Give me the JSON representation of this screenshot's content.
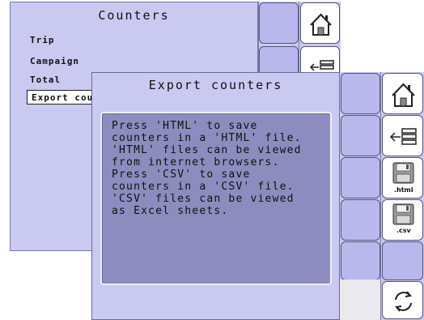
{
  "background_screen": {
    "title": "Counters",
    "items": [
      {
        "label": "Trip"
      },
      {
        "label": "Campaign"
      },
      {
        "label": "Total"
      },
      {
        "label": "Export coun"
      }
    ]
  },
  "dialog": {
    "title": "Export counters",
    "message": "Press 'HTML' to save\ncounters in  a 'HTML' file.\n'HTML' files can be viewed\nfrom internet browsers.\nPress 'CSV' to save\ncounters in  a 'CSV' file.\n'CSV' files can be viewed\nas Excel sheets.",
    "buttons": {
      "home_icon": "home-icon",
      "back_icon": "back-list-icon",
      "html_label": ".html",
      "csv_label": ".csv",
      "refresh_icon": "refresh-icon"
    }
  },
  "colors": {
    "panel": "#c9c9f2",
    "button": "#b8b8ec",
    "message_box": "#8c8cbf"
  }
}
